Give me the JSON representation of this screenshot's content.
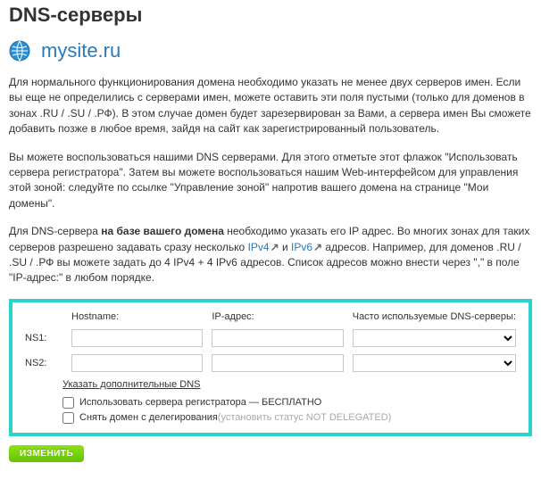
{
  "title": "DNS-серверы",
  "domain": "mysite.ru",
  "paragraphs": {
    "p1": "Для нормального функционирования домена необходимо указать не менее двух серверов имен. Если вы еще не определились с серверами имен, можете оставить эти поля пустыми (только для доменов в зонах .RU / .SU / .РФ). В этом случае домен будет зарезервирован за Вами, а сервера имен Вы сможете добавить позже в любое время, зайдя на сайт как зарегистрированный пользователь.",
    "p2": "Вы можете воспользоваться нашими DNS серверами. Для этого отметьте этот флажок \"Использовать сервера регистратора\". Затем вы можете воспользоваться нашим Web-интерфейсом для управления этой зоной: следуйте по ссылке \"Управление зоной\" напротив вашего домена на странице \"Мои домены\".",
    "p3_pre": "Для DNS-сервера ",
    "p3_bold": "на базе вашего домена",
    "p3_mid1": " необходимо указать его IP адрес. Во многих зонах для таких серверов разрешено задавать сразу несколько ",
    "ipv4": "IPv4",
    "p3_mid2": " и ",
    "ipv6": "IPv6",
    "p3_tail": " адресов. Например, для доменов .RU / .SU / .РФ вы можете задать до 4 IPv4 + 4 IPv6 адресов. Список адресов можно внести через \",\" в поле \"IP-адрес:\" в любом порядке."
  },
  "panel": {
    "headers": {
      "host": "Hostname:",
      "ip": "IP-адрес:",
      "preset": "Часто используемые DNS-серверы:"
    },
    "rows": [
      {
        "label": "NS1:",
        "host": "",
        "ip": ""
      },
      {
        "label": "NS2:",
        "host": "",
        "ip": ""
      }
    ],
    "extra_link": "Указать дополнительные DNS",
    "cb_registrar": "Использовать сервера регистратора — БЕСПЛАТНО",
    "cb_undelegate_a": "Снять домен с делегирования ",
    "cb_undelegate_b": "(установить статус NOT DELEGATED)"
  },
  "submit_label": "ИЗМЕНИТЬ"
}
